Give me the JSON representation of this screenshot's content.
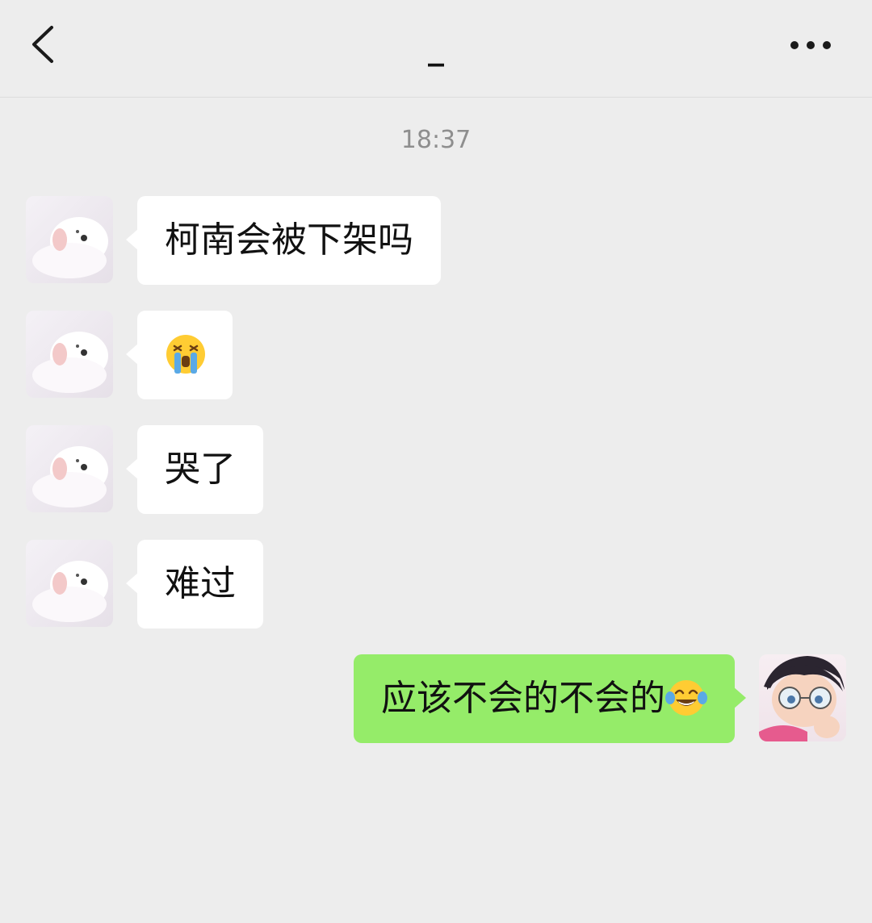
{
  "header": {
    "title": "_",
    "back_icon": "chevron-left-icon",
    "more_icon": "more-horizontal-icon"
  },
  "timestamp": "18:37",
  "messages": [
    {
      "side": "left",
      "text": "柯南会被下架吗"
    },
    {
      "side": "left",
      "text": "",
      "emoji": "loudly-crying-face"
    },
    {
      "side": "left",
      "text": "哭了"
    },
    {
      "side": "left",
      "text": "难过"
    },
    {
      "side": "right",
      "text": "应该不会的不会的",
      "emoji": "face-with-tears-of-joy"
    }
  ],
  "colors": {
    "background": "#ededed",
    "incoming_bubble": "#ffffff",
    "outgoing_bubble": "#95ec69",
    "timestamp": "#8e8e8e"
  }
}
